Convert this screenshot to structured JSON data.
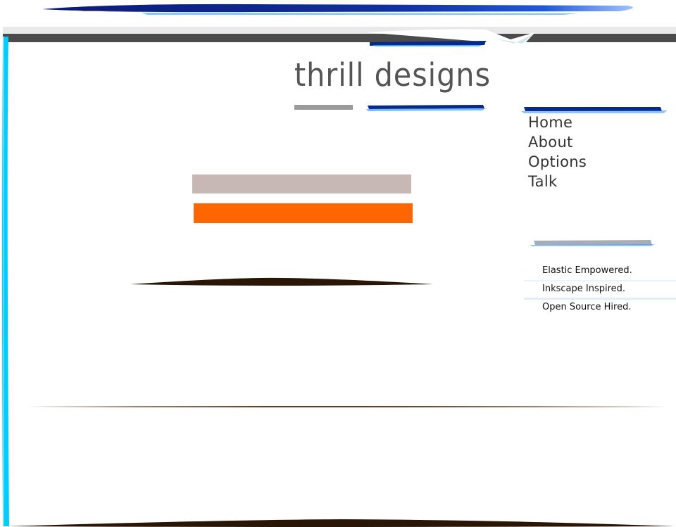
{
  "site": {
    "title": "thrill designs"
  },
  "nav": {
    "items": [
      {
        "label": "Home"
      },
      {
        "label": "About"
      },
      {
        "label": "Options"
      },
      {
        "label": "Talk"
      }
    ]
  },
  "sidebar": {
    "items": [
      {
        "label": "Elastic Empowered."
      },
      {
        "label": "Inkscape Inspired."
      },
      {
        "label": "Open Source Hired."
      }
    ]
  },
  "colors": {
    "accent_blue": "#0a2a8a",
    "cyan": "#00ccff",
    "orange": "#ff6600",
    "tan": "#c7b7b5",
    "brown": "#2a1606",
    "header_dark": "#4b4b4b"
  }
}
